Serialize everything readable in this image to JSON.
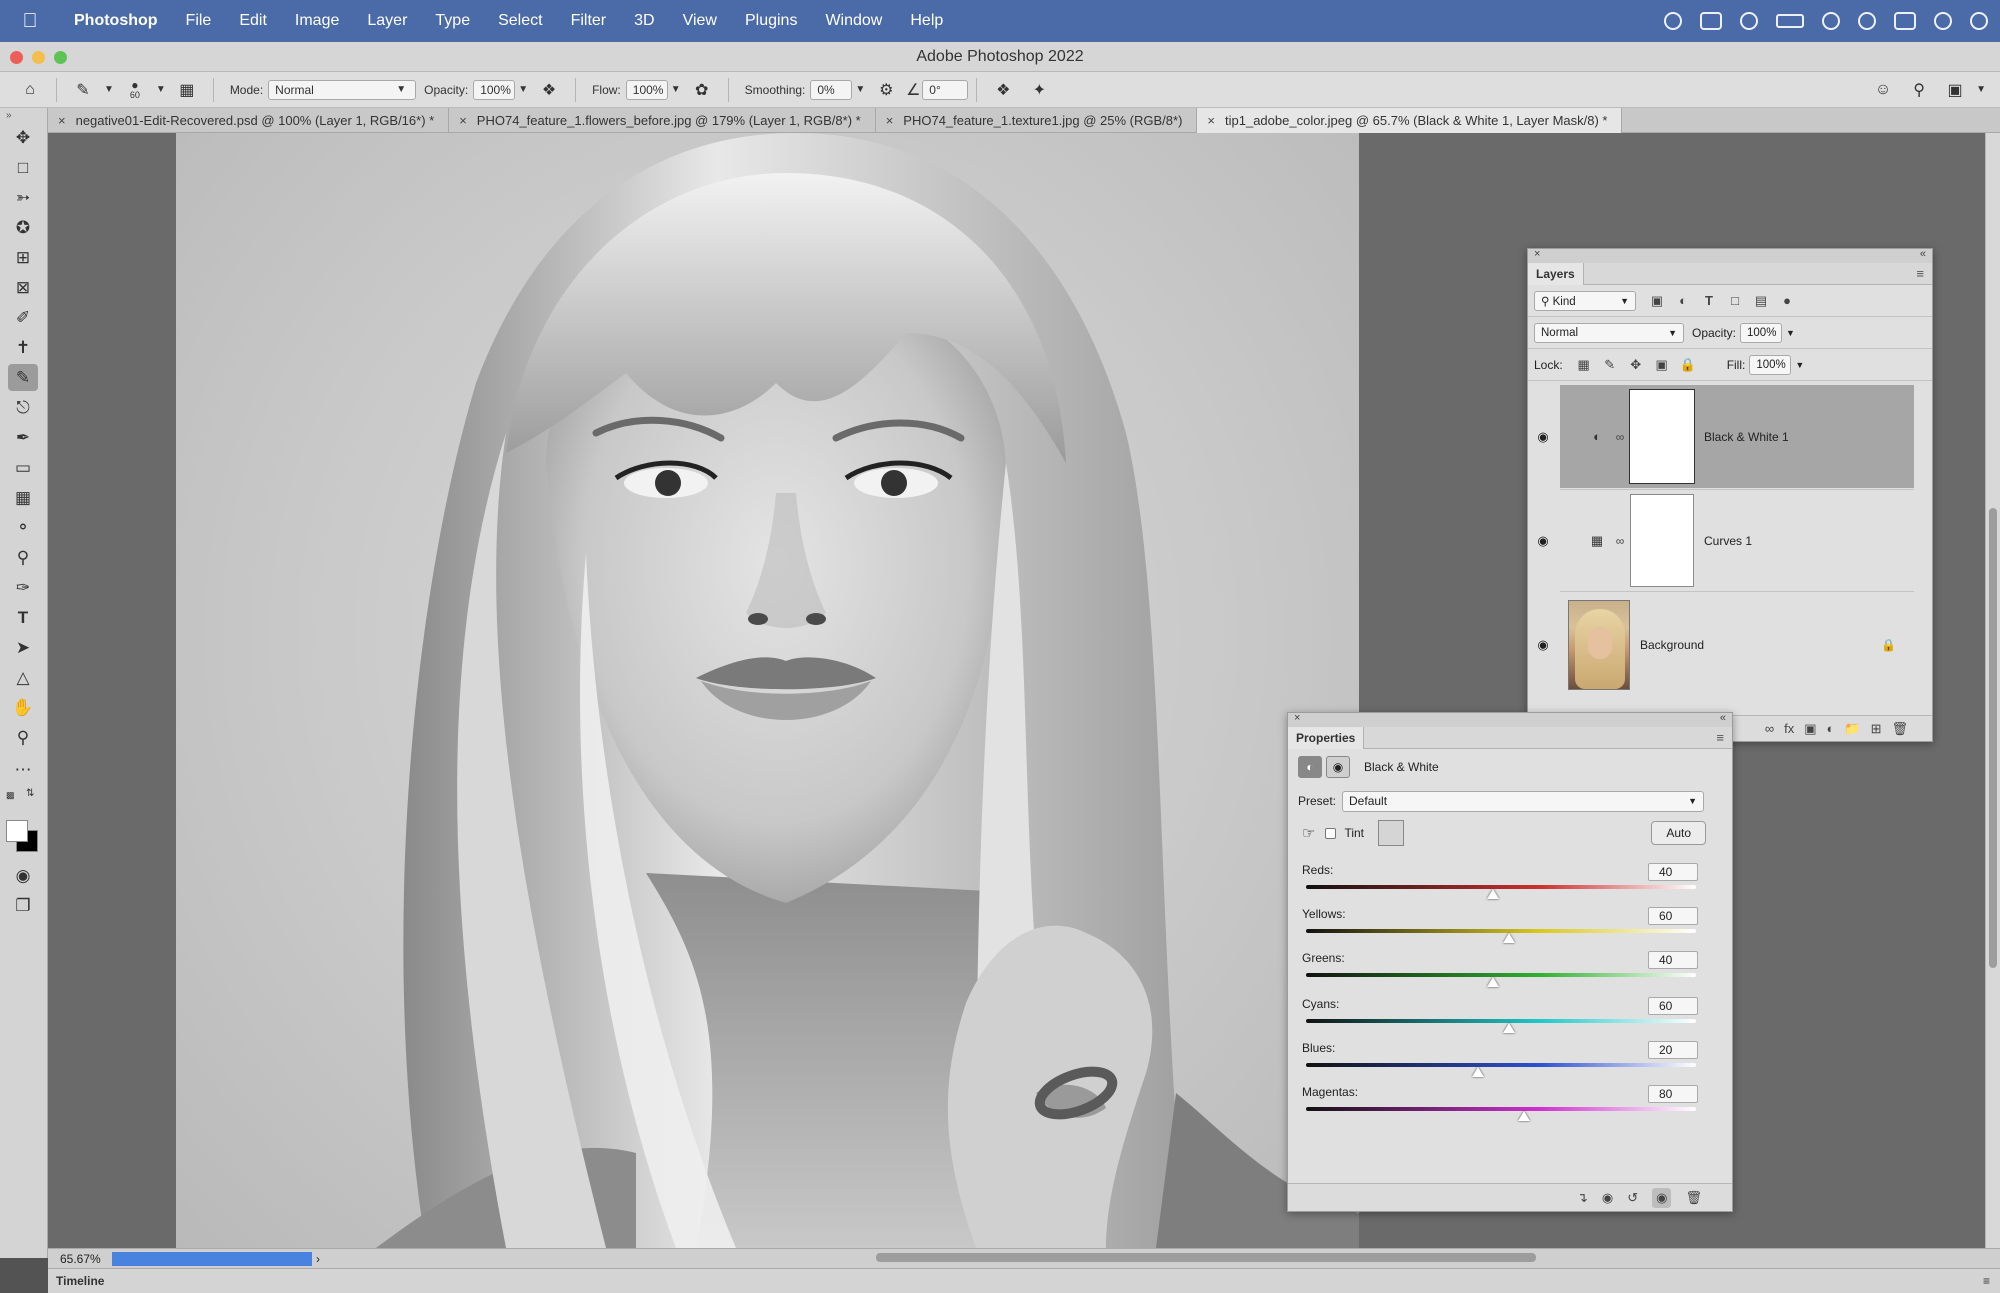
{
  "menubar": {
    "apple": "",
    "items": [
      "Photoshop",
      "File",
      "Edit",
      "Image",
      "Layer",
      "Type",
      "Select",
      "Filter",
      "3D",
      "View",
      "Plugins",
      "Window",
      "Help"
    ]
  },
  "window": {
    "title": "Adobe Photoshop 2022"
  },
  "options": {
    "brush_size": "60",
    "mode_label": "Mode:",
    "mode_value": "Normal",
    "opacity_label": "Opacity:",
    "opacity_value": "100%",
    "flow_label": "Flow:",
    "flow_value": "100%",
    "smoothing_label": "Smoothing:",
    "smoothing_value": "0%",
    "angle_value": "0°"
  },
  "tabs": [
    "negative01-Edit-Recovered.psd @ 100% (Layer 1, RGB/16*) *",
    "PHO74_feature_1.flowers_before.jpg @ 179% (Layer 1, RGB/8*) *",
    "PHO74_feature_1.texture1.jpg @ 25% (RGB/8*)",
    "tip1_adobe_color.jpeg @ 65.7% (Black & White 1, Layer Mask/8) *"
  ],
  "status": {
    "zoom": "65.67%"
  },
  "timeline": {
    "label": "Timeline"
  },
  "layers": {
    "tab": "Layers",
    "kind_label": "Kind",
    "blend_mode": "Normal",
    "opacity_label": "Opacity:",
    "opacity_value": "100%",
    "lock_label": "Lock:",
    "fill_label": "Fill:",
    "fill_value": "100%",
    "items": [
      {
        "name": "Black & White 1",
        "selected": true
      },
      {
        "name": "Curves 1",
        "selected": false
      },
      {
        "name": "Background",
        "selected": false
      }
    ]
  },
  "properties": {
    "tab": "Properties",
    "adjustment_name": "Black & White",
    "preset_label": "Preset:",
    "preset_value": "Default",
    "tint_label": "Tint",
    "auto_label": "Auto",
    "sliders": [
      {
        "label": "Reds:",
        "value": "40",
        "min": -200,
        "max": 300,
        "gradient": "#cc3030"
      },
      {
        "label": "Yellows:",
        "value": "60",
        "min": -200,
        "max": 300,
        "gradient": "#d8c820"
      },
      {
        "label": "Greens:",
        "value": "40",
        "min": -200,
        "max": 300,
        "gradient": "#30b030"
      },
      {
        "label": "Cyans:",
        "value": "60",
        "min": -200,
        "max": 300,
        "gradient": "#20c8c8"
      },
      {
        "label": "Blues:",
        "value": "20",
        "min": -200,
        "max": 300,
        "gradient": "#3050d0"
      },
      {
        "label": "Magentas:",
        "value": "80",
        "min": -200,
        "max": 300,
        "gradient": "#d030d0"
      }
    ]
  },
  "colors": {
    "menubar": "#4a6aa8",
    "selection": "#4a82e0"
  }
}
